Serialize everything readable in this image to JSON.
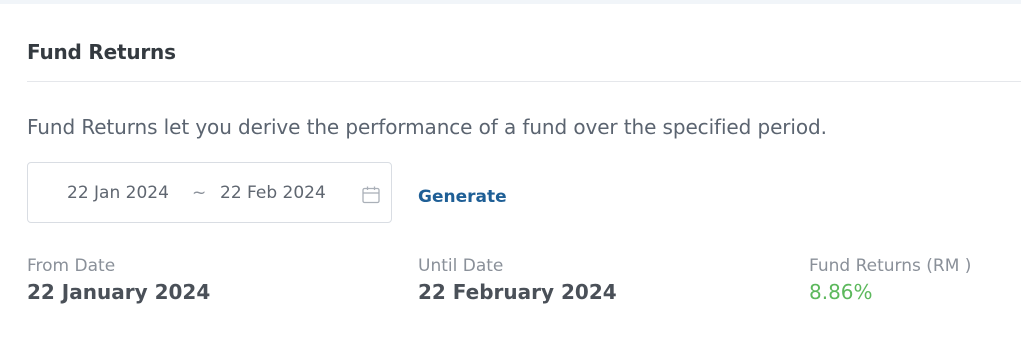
{
  "card": {
    "title": "Fund Returns",
    "description": "Fund Returns let you derive the performance of a fund over the specified period."
  },
  "date_range": {
    "start": "22 Jan 2024",
    "separator": "~",
    "end": "22 Feb 2024",
    "icon": "calendar-icon"
  },
  "actions": {
    "generate_label": "Generate"
  },
  "results": {
    "from_label": "From Date",
    "from_value": "22 January 2024",
    "until_label": "Until Date",
    "until_value": "22 February 2024",
    "returns_label": "Fund Returns (RM )",
    "returns_value": "8.86%"
  },
  "colors": {
    "accent": "#1f5f96",
    "positive": "#5cb85c",
    "divider": "#e5e7eb"
  }
}
